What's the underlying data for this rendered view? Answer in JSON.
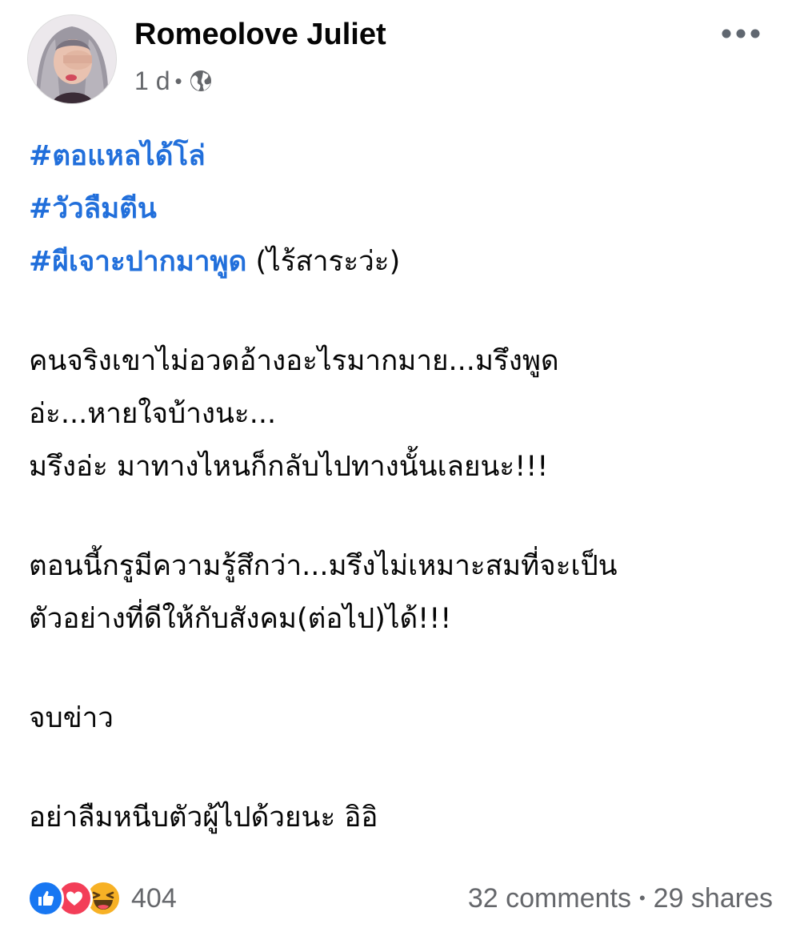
{
  "post": {
    "author": "Romeolove Juliet",
    "timestamp": "1 d",
    "separator": "•",
    "privacy_icon": "globe-icon",
    "menu_icon": "more-options-icon"
  },
  "body": {
    "hashtags": [
      "#ตอแหลได้โล่",
      "#วัวลืมตีน",
      "#ผีเจาะปากมาพูด"
    ],
    "hashtag_suffix": " (ไร้สาระว่ะ)",
    "paragraph1": [
      "คนจริงเขาไม่อวดอ้างอะไรมากมาย...มรึงพูด",
      "อ่ะ...หายใจบ้างนะ...",
      "มรึงอ่ะ มาทางไหนก็กลับไปทางนั้นเลยนะ!!!"
    ],
    "paragraph2": [
      "ตอนนี้กรูมีความรู้สึกว่า...มรึงไม่เหมาะสมที่จะเป็น",
      "ตัวอย่างที่ดีให้กับสังคม(ต่อไป)ได้!!!"
    ],
    "paragraph3": "จบข่าว",
    "paragraph4": "อย่าลืมหนีบตัวผู้ไปด้วยนะ อิอิ"
  },
  "footer": {
    "reaction_icons": [
      "like-icon",
      "love-icon",
      "haha-icon"
    ],
    "reaction_count": "404",
    "comments": "32 comments",
    "separator": "•",
    "shares": "29 shares"
  },
  "colors": {
    "hashtag": "#216fdb",
    "like": "#1877f2",
    "love": "#f33e58",
    "haha": "#f7b125",
    "meta_text": "#65676b"
  }
}
